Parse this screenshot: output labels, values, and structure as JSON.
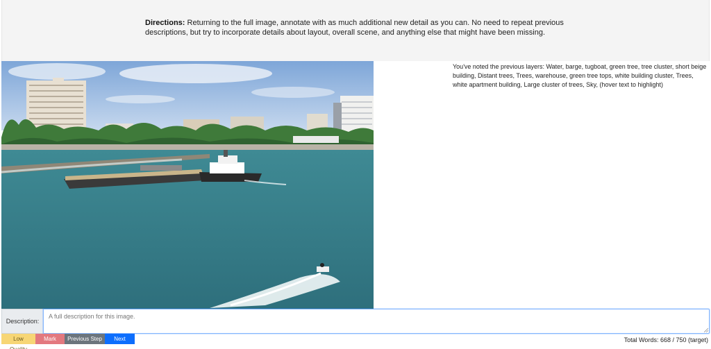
{
  "directions": {
    "label": "Directions:",
    "text": "Returning to the full image, annotate with as much additional new detail as you can. No need to repeat previous descriptions, but try to incorporate details about layout, overall scene, and anything else that might have been missing."
  },
  "layers_note": "You've noted the previous layers: Water, barge, tugboat, green tree, tree cluster, short beige building, Distant trees, Trees, warehouse, green tree tops, white building cluster, Trees, white apartment building, Large cluster of trees, Sky, (hover text to highlight)",
  "description": {
    "label": "Description:",
    "placeholder": "A full description for this image.",
    "value": ""
  },
  "buttons": {
    "low_quality": "Low Quality",
    "mark_bad": "Mark Bad",
    "previous_step": "Previous Step",
    "next_step": "Next Step"
  },
  "word_count": "Total Words: 668 / 750 (target)",
  "colors": {
    "low_quality": "#f7d675",
    "mark_bad": "#e3797f",
    "previous_step": "#6c757d",
    "next_step": "#0d6efd"
  }
}
